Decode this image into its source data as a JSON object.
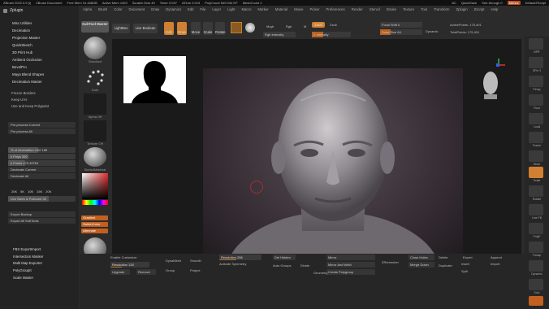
{
  "title_bar": {
    "app": "ZBrush 2022.0.5 (l)",
    "doc": "ZBrush Document",
    "free_mem": "Free Mem 31.468GB",
    "active_mem": "Active Mem 1403",
    "scratch_disk": "Scratch Disk 49",
    "timer": "Timer 0.097",
    "atime": "ATime 0.015",
    "polycount": "PolyCount 549.934 KP",
    "meshcount": "MeshCount 1",
    "ac": "AC",
    "quicksave": "QuickSave",
    "see_through": "See-through 0",
    "menus": "Menus",
    "script": "DefaultZScript"
  },
  "menubar": [
    "Alpha",
    "Brush",
    "Color",
    "Document",
    "Draw",
    "Dynamics",
    "Edit",
    "File",
    "Layer",
    "Light",
    "Macro",
    "Marker",
    "Material",
    "Movie",
    "Picker",
    "Preferences",
    "Render",
    "Stencil",
    "Stroke",
    "Texture",
    "Tool",
    "Transform",
    "Zplugin",
    "Zscript",
    "Help"
  ],
  "left_panel": {
    "header": "Zplugin",
    "plugins": [
      "Misc Utilities",
      "Decimation",
      "Projection Master",
      "QuickSketch",
      "3D Print Hub",
      "Ambient Occlusion",
      "BevelPro",
      "Maya Blend Shapes",
      "Decimation Master"
    ],
    "options": [
      "Freeze Borders",
      "Keep UVs",
      "Use and Keep Polypaint"
    ],
    "sliders": [
      {
        "label": "Pre-process Current",
        "fill": 0.0
      },
      {
        "label": "Pre-process All",
        "fill": 0.0
      }
    ],
    "decimate": [
      {
        "label": "% of decimation 4.92 189",
        "fill": 0.45
      },
      {
        "label": "k Polys 350",
        "fill": 0.3
      },
      {
        "label": "k Points 175.39763",
        "fill": 0.25
      }
    ],
    "buttons": [
      "Decimate Current",
      "Decimate All"
    ],
    "counts": [
      "20K",
      "5K",
      "10K",
      "15K",
      "20K"
    ],
    "uv_label": "Uvs Sizes & Polcount 30",
    "bottom_list": [
      "FBX ExportImport",
      "Intersection Masker",
      "Multi Map Exporter",
      "PolyGroupIt",
      "Scale Master"
    ],
    "extra": [
      "Export Backup",
      "Export All SubTools"
    ]
  },
  "toolbox": {
    "subtool_master": "SubTool Master",
    "labels": [
      "Standard",
      "Dots",
      "Alpha Off",
      "Texture Off",
      "SketchMaterial"
    ],
    "orange": [
      "Gradient",
      "SwitchColor",
      "Alternate"
    ],
    "bottom_label": "Default4Sphere"
  },
  "topbar": {
    "buttons": [
      "LightBox",
      "Live Boolean",
      "Edit",
      "Draw",
      "Move",
      "Scale",
      "Rotate"
    ],
    "mrgb": "Mrgb",
    "rgb": "Rgb",
    "m": "M",
    "zadd": "Zadd",
    "zsub": "Zsub",
    "zcut": "Zcut",
    "focal_shift": "Focal Shift 0",
    "draw_size": "Draw Size 64",
    "dynamic": "Dynamic",
    "active_points": "ActivePoints: 175,401",
    "total_points": "TotalPoints: 175,401",
    "rgb_intensity": "Rgb Intensity",
    "z_intensity": "Z Intensity"
  },
  "right_bar": [
    "BPR",
    "SPix 3",
    "Persp",
    "Floor",
    "Local",
    "Frame",
    "Move",
    "Scale",
    "Rotate",
    "Line Fill",
    "PolyF",
    "Transp",
    "Dynamic",
    "Solo",
    "Xpose"
  ],
  "bottom_bar": {
    "items": [
      "Enable Customize",
      "Resolution 128",
      "Upgrade",
      "Remove",
      "DynaMesh",
      "Group",
      "Project",
      "Smooth",
      "Resolution 256",
      "Activate Symmetry",
      "Del Hidden",
      "Auto Groups",
      "Mirror",
      "Mirror And Weld",
      "Close Holes",
      "ZRemesher",
      "Divide",
      "Create Polygroup",
      "Geometry",
      "Merge Down",
      "Append",
      "Insert",
      "Export",
      "Import",
      "Duplicate",
      "Delete",
      "Split"
    ]
  },
  "colors": {
    "accent": "#c26020",
    "bg": "#2b2b2b",
    "panel": "#232323"
  }
}
